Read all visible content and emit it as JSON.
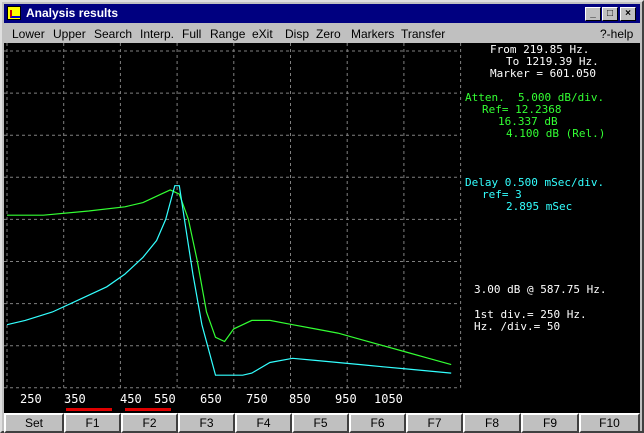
{
  "window": {
    "title": "Analysis results",
    "buttons": [
      "_",
      "□",
      "×"
    ]
  },
  "menu": {
    "items": [
      "Lower",
      "Upper",
      "Search",
      "Interp.",
      "Full",
      "Range",
      "eXit",
      "Disp",
      "Zero",
      "Markers",
      "Transfer"
    ],
    "help": "?-help"
  },
  "info": {
    "from": "From 219.85 Hz.",
    "to": "To 1219.39 Hz.",
    "marker": "Marker = 601.050",
    "atten": "Atten.  5.000 dB/div.",
    "ref": "Ref= 12.2368",
    "level": "16.337 dB",
    "rel": "4.100 dB (Rel.)",
    "delay": "Delay 0.500 mSec/div.",
    "delay_ref": "ref= 3",
    "delay_value": "2.895 mSec",
    "bandwidth": "3.00 dB @ 587.75 Hz.",
    "first_div": "1st div.= 250 Hz.",
    "hz_div": "Hz. /div.= 50"
  },
  "colors": {
    "attenuation": "#33ff33",
    "delay": "#33ffff",
    "marker": "#e00000"
  },
  "fkeys": [
    "Set",
    "F1",
    "F2",
    "F3",
    "F4",
    "F5",
    "F6",
    "F7",
    "F8",
    "F9",
    "F10"
  ],
  "chart_data": {
    "type": "line",
    "x_tick_labels": [
      "250",
      "350",
      "450",
      "550",
      "650",
      "750",
      "850",
      "950",
      "1050"
    ],
    "xlim": [
      219.85,
      1219.39
    ],
    "grid": true,
    "series": [
      {
        "color": "#33ff33",
        "x": [
          219.85,
          300,
          400,
          480,
          520,
          560,
          580,
          600,
          620,
          640,
          660,
          680,
          700,
          720,
          740,
          760,
          800,
          850,
          900,
          950,
          1000,
          1050,
          1100,
          1150,
          1200
        ],
        "y": [
          3.9,
          3.9,
          3.8,
          3.7,
          3.6,
          3.4,
          3.3,
          3.4,
          4.0,
          5.0,
          6.2,
          6.8,
          6.9,
          6.6,
          6.5,
          6.4,
          6.4,
          6.5,
          6.6,
          6.7,
          6.85,
          7.0,
          7.15,
          7.3,
          7.45
        ]
      },
      {
        "color": "#33ffff",
        "x": [
          219.85,
          260,
          320,
          380,
          440,
          480,
          520,
          550,
          570,
          590,
          600,
          610,
          630,
          650,
          680,
          700,
          720,
          740,
          760,
          800,
          850,
          900,
          950,
          1000,
          1050,
          1100,
          1150,
          1200
        ],
        "y": [
          6.5,
          6.4,
          6.2,
          5.9,
          5.6,
          5.3,
          4.9,
          4.5,
          4.0,
          3.2,
          3.2,
          3.9,
          5.3,
          6.5,
          7.7,
          7.7,
          7.7,
          7.7,
          7.65,
          7.4,
          7.3,
          7.35,
          7.4,
          7.45,
          7.5,
          7.55,
          7.6,
          7.65
        ]
      }
    ]
  }
}
